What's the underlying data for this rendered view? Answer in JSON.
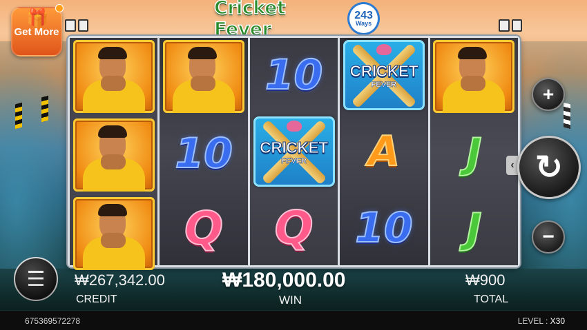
{
  "header": {
    "get_more_label": "Get More",
    "logo_text": "Cricket Fever",
    "logo_ways_number": "243",
    "logo_ways_label": "Ways"
  },
  "reels": [
    [
      "player",
      "player",
      "player"
    ],
    [
      "player",
      "10",
      "Q"
    ],
    [
      "10",
      "wild",
      "Q"
    ],
    [
      "wild",
      "A",
      "10"
    ],
    [
      "player",
      "J",
      "J"
    ]
  ],
  "symbols": {
    "ten": "10",
    "a": "A",
    "j": "J",
    "q": "Q",
    "wild_line1": "CRICKET",
    "wild_line2": "FEVER"
  },
  "controls": {
    "plus": "+",
    "minus": "−",
    "spin": "↻",
    "menu": "☰",
    "collapse": "‹"
  },
  "stats": {
    "credit_value": "₩267,342.00",
    "credit_label": "CREDIT",
    "win_value": "₩180,000.00",
    "win_label": "WIN",
    "total_value": "₩900",
    "total_label": "TOTAL"
  },
  "footer": {
    "session_id": "675369572278",
    "level_label": "LEVEL :",
    "level_value": "X30"
  },
  "colors": {
    "logo_green": "#2a8c2a",
    "ways_blue": "#2c7bd3",
    "get_more_orange": "#e0551a",
    "symbol_ten": "#3a6cf0",
    "symbol_a": "#ff9a1a",
    "symbol_j": "#4bc83a",
    "symbol_q": "#ff5a8a"
  }
}
